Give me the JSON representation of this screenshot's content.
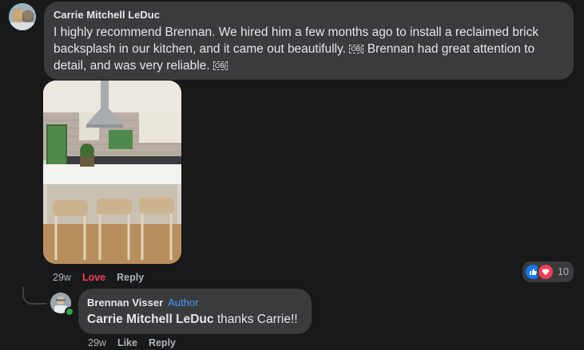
{
  "comment": {
    "author": "Carrie Mitchell LeDuc",
    "text_part1": "I highly recommend Brennan. We hired him a few months ago to install a reclaimed brick backsplash in our kitchen, and it came out beautifully.",
    "obj_marker": "OBJ",
    "text_part2": "Brennan had great attention to detail, and was very reliable.",
    "time": "29w",
    "love_label": "Love",
    "reply_label": "Reply",
    "reaction_count": "10",
    "reaction_icons": [
      "like-icon",
      "love-icon"
    ],
    "photo_alt": "kitchen photo"
  },
  "reply": {
    "author": "Brennan Visser",
    "badge": "Author",
    "mention": "Carrie Mitchell LeDuc",
    "text": "thanks Carrie!!",
    "time": "29w",
    "like_label": "Like",
    "reply_label": "Reply"
  },
  "colors": {
    "background": "#18191a",
    "bubble": "#3a3b3c",
    "love": "#f33e58",
    "author_badge": "#4599ff",
    "like_blue": "#1877f2"
  }
}
